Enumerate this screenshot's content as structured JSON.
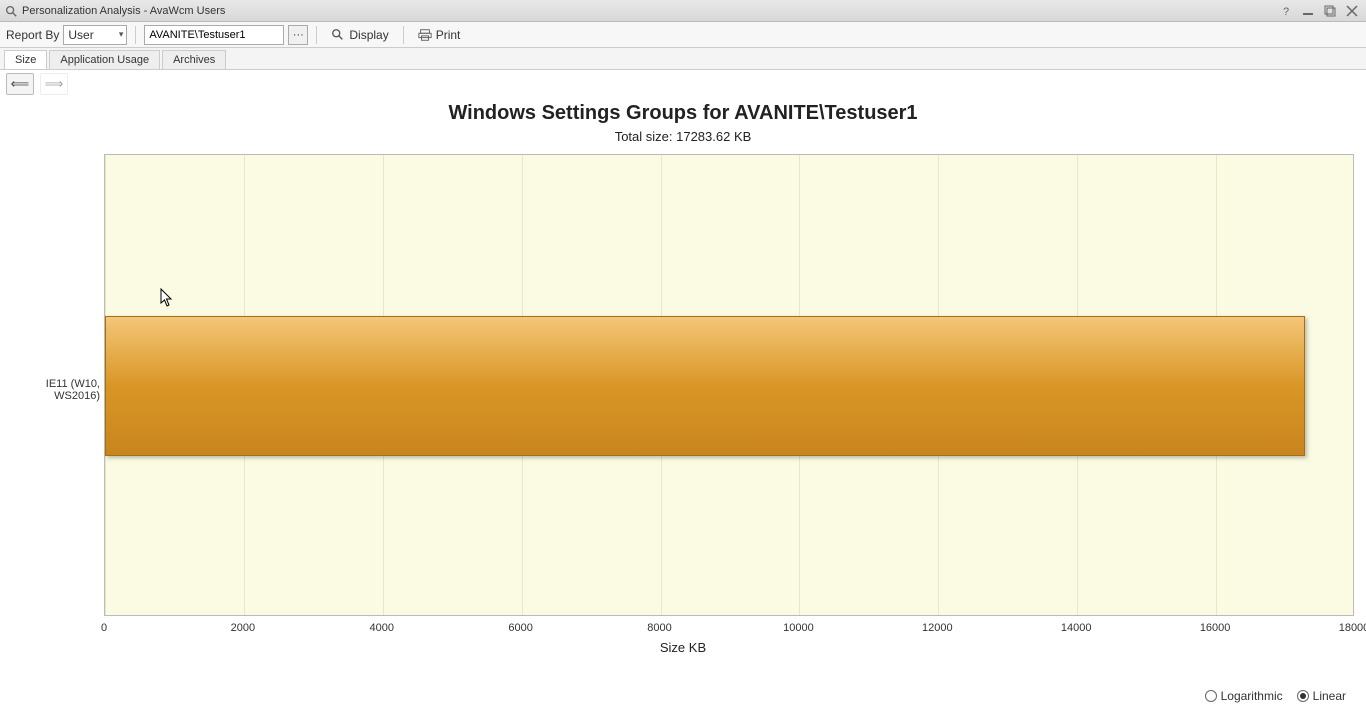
{
  "window": {
    "title": "Personalization Analysis - AvaWcm Users"
  },
  "toolbar": {
    "report_by_label": "Report By",
    "report_by_value": "User",
    "target_value": "AVANITE\\Testuser1",
    "display_label": "Display",
    "print_label": "Print"
  },
  "tabs": {
    "size": "Size",
    "app_usage": "Application Usage",
    "archives": "Archives"
  },
  "chart": {
    "title": "Windows Settings Groups for AVANITE\\Testuser1",
    "subtitle": "Total size: 17283.62 KB",
    "xlabel": "Size KB"
  },
  "scale": {
    "log": "Logarithmic",
    "lin": "Linear",
    "selected": "Linear"
  },
  "chart_data": {
    "type": "bar",
    "orientation": "horizontal",
    "categories": [
      "IE11 (W10, WS2016)"
    ],
    "values": [
      17283.62
    ],
    "title": "Windows Settings Groups for AVANITE\\Testuser1",
    "xlabel": "Size KB",
    "ylabel": "",
    "xlim": [
      0,
      18000
    ],
    "xticks": [
      0,
      2000,
      4000,
      6000,
      8000,
      10000,
      12000,
      14000,
      16000,
      18000
    ],
    "grid": true
  }
}
